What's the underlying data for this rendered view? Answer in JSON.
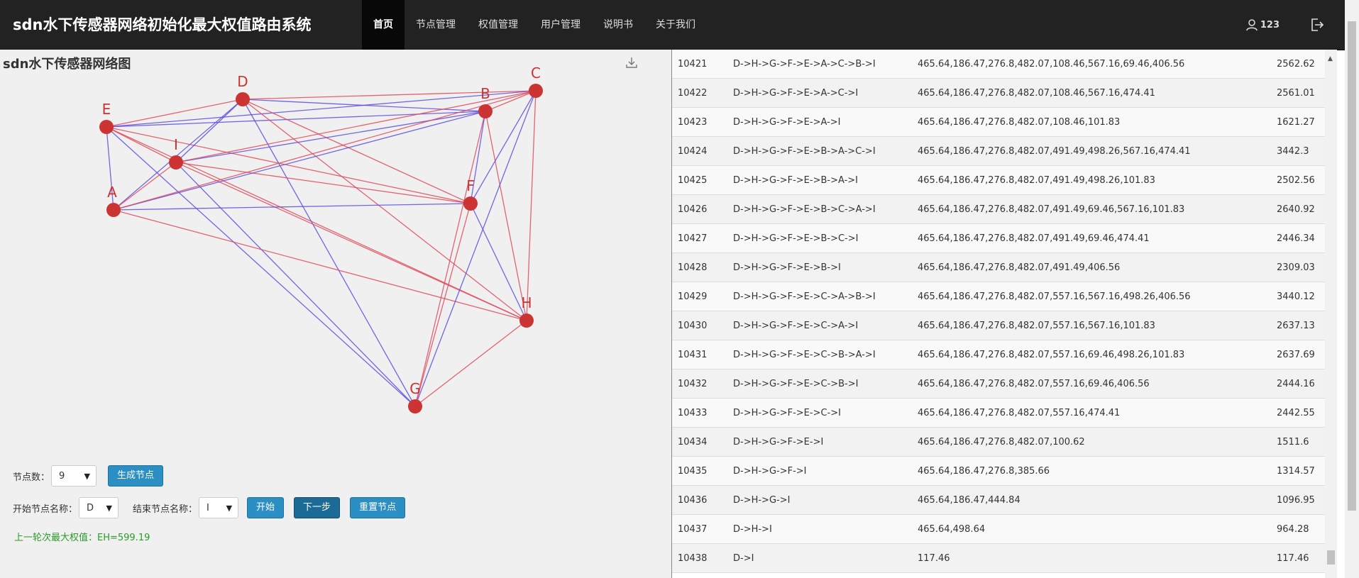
{
  "app": {
    "brand": "sdn水下传感器网络初始化最大权值路由系统"
  },
  "nav": {
    "items": [
      {
        "label": "首页",
        "active": true
      },
      {
        "label": "节点管理",
        "active": false
      },
      {
        "label": "权值管理",
        "active": false
      },
      {
        "label": "用户管理",
        "active": false
      },
      {
        "label": "说明书",
        "active": false
      },
      {
        "label": "关于我们",
        "active": false
      }
    ],
    "user": "123"
  },
  "graph": {
    "title": "sdn水下传感器网络图",
    "nodes": [
      "A",
      "B",
      "C",
      "D",
      "E",
      "F",
      "G",
      "H",
      "I"
    ]
  },
  "controls": {
    "node_count_label": "节点数：",
    "node_count_value": "9",
    "generate_button": "生成节点",
    "start_label": "开始节点名称：",
    "start_value": "D",
    "end_label": "结束节点名称：",
    "end_value": "I",
    "start_button": "开始",
    "next_button": "下一步",
    "reset_button": "重置节点",
    "status": "上一轮次最大权值：EH=599.19"
  },
  "table": {
    "rows": [
      [
        "10421",
        "D->H->G->F->E->A->C->B->I",
        "465.64,186.47,276.8,482.07,108.46,567.16,69.46,406.56",
        "2562.62"
      ],
      [
        "10422",
        "D->H->G->F->E->A->C->I",
        "465.64,186.47,276.8,482.07,108.46,567.16,474.41",
        "2561.01"
      ],
      [
        "10423",
        "D->H->G->F->E->A->I",
        "465.64,186.47,276.8,482.07,108.46,101.83",
        "1621.27"
      ],
      [
        "10424",
        "D->H->G->F->E->B->A->C->I",
        "465.64,186.47,276.8,482.07,491.49,498.26,567.16,474.41",
        "3442.3"
      ],
      [
        "10425",
        "D->H->G->F->E->B->A->I",
        "465.64,186.47,276.8,482.07,491.49,498.26,101.83",
        "2502.56"
      ],
      [
        "10426",
        "D->H->G->F->E->B->C->A->I",
        "465.64,186.47,276.8,482.07,491.49,69.46,567.16,101.83",
        "2640.92"
      ],
      [
        "10427",
        "D->H->G->F->E->B->C->I",
        "465.64,186.47,276.8,482.07,491.49,69.46,474.41",
        "2446.34"
      ],
      [
        "10428",
        "D->H->G->F->E->B->I",
        "465.64,186.47,276.8,482.07,491.49,406.56",
        "2309.03"
      ],
      [
        "10429",
        "D->H->G->F->E->C->A->B->I",
        "465.64,186.47,276.8,482.07,557.16,567.16,498.26,406.56",
        "3440.12"
      ],
      [
        "10430",
        "D->H->G->F->E->C->A->I",
        "465.64,186.47,276.8,482.07,557.16,567.16,101.83",
        "2637.13"
      ],
      [
        "10431",
        "D->H->G->F->E->C->B->A->I",
        "465.64,186.47,276.8,482.07,557.16,69.46,498.26,101.83",
        "2637.69"
      ],
      [
        "10432",
        "D->H->G->F->E->C->B->I",
        "465.64,186.47,276.8,482.07,557.16,69.46,406.56",
        "2444.16"
      ],
      [
        "10433",
        "D->H->G->F->E->C->I",
        "465.64,186.47,276.8,482.07,557.16,474.41",
        "2442.55"
      ],
      [
        "10434",
        "D->H->G->F->E->I",
        "465.64,186.47,276.8,482.07,100.62",
        "1511.6"
      ],
      [
        "10435",
        "D->H->G->F->I",
        "465.64,186.47,276.8,385.66",
        "1314.57"
      ],
      [
        "10436",
        "D->H->G->I",
        "465.64,186.47,444.84",
        "1096.95"
      ],
      [
        "10437",
        "D->H->I",
        "465.64,498.64",
        "964.28"
      ],
      [
        "10438",
        "D->I",
        "117.46",
        "117.46"
      ]
    ]
  },
  "colors": {
    "node": "#cc3333",
    "edge_blue": "#5a4ee0",
    "edge_red": "#e04a5a",
    "status": "#2a9a2a"
  }
}
